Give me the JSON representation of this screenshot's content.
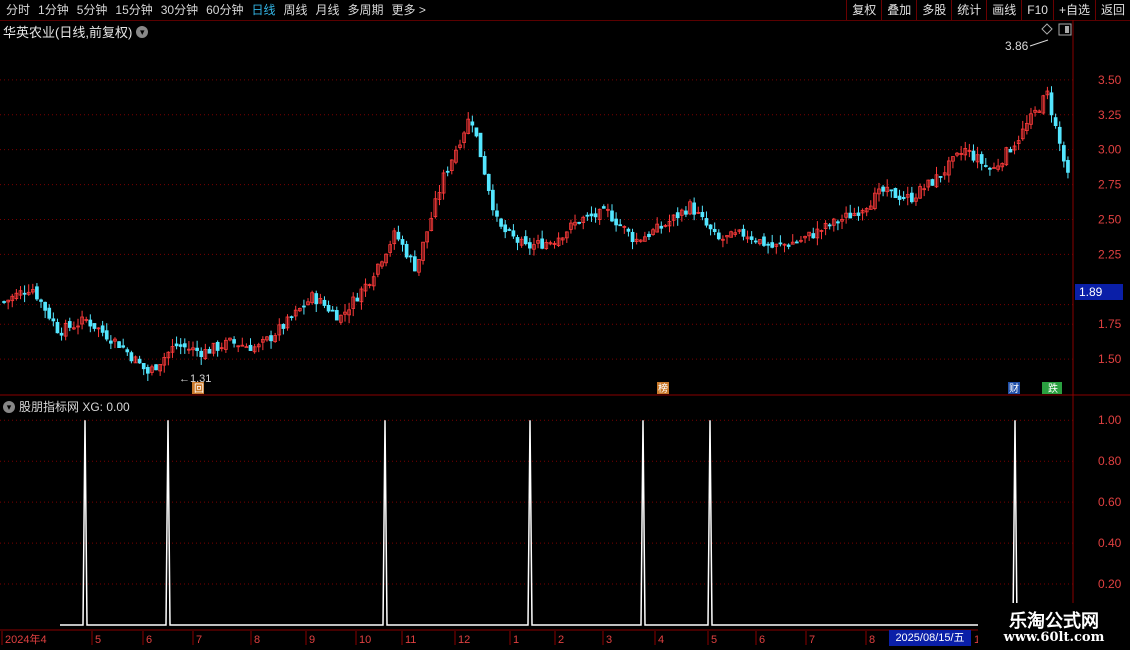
{
  "toolbar": {
    "periods": [
      "分时",
      "1分钟",
      "5分钟",
      "15分钟",
      "30分钟",
      "60分钟",
      "日线",
      "周线",
      "月线",
      "多周期",
      "更多 >"
    ],
    "active_period": "日线",
    "buttons": [
      "复权",
      "叠加",
      "多股",
      "统计",
      "画线",
      "F10",
      "+自选",
      "返回"
    ]
  },
  "stock": {
    "title": "华英农业(日线,前复权)"
  },
  "price_axis": {
    "ticks": [
      "3.50",
      "3.25",
      "3.00",
      "2.75",
      "2.50",
      "2.25",
      "1.75",
      "1.50"
    ],
    "current": "1.89"
  },
  "annotations": {
    "high": "3.86",
    "low": "1.31",
    "badge_hui": "回",
    "badge_bang": "榜",
    "badge_cai": "财",
    "badge_die": "跌"
  },
  "indicator": {
    "title": "股朋指标网 XG: 0.00",
    "ticks": [
      "1.00",
      "0.80",
      "0.60",
      "0.40",
      "0.20"
    ]
  },
  "time_axis": {
    "labels": [
      "2024年4",
      "5",
      "6",
      "7",
      "8",
      "9",
      "10",
      "11",
      "12",
      "1",
      "2",
      "3",
      "4",
      "5",
      "6",
      "7",
      "8"
    ],
    "current_date": "2025/08/15/五",
    "tail": "1"
  },
  "watermark": {
    "title": "乐淘公式网",
    "url": "www.60lt.com"
  },
  "colors": {
    "up": "#ff3b3b",
    "down": "#54e6ff",
    "grid": "#7a0000",
    "active": "#33b5e5",
    "highlight": "#0a1fa8"
  },
  "chart_data": {
    "type": "candlestick",
    "title": "华英农业(日线,前复权)",
    "y_ticks": [
      3.5,
      3.25,
      3.0,
      2.75,
      2.5,
      2.25,
      1.75,
      1.5
    ],
    "ylim": [
      1.25,
      3.9
    ],
    "close_path": [
      [
        2024.25,
        1.91
      ],
      [
        2024.29,
        2.02
      ],
      [
        2024.33,
        1.7
      ],
      [
        2024.37,
        1.78
      ],
      [
        2024.42,
        1.6
      ],
      [
        2024.46,
        1.4
      ],
      [
        2024.5,
        1.6
      ],
      [
        2024.54,
        1.55
      ],
      [
        2024.58,
        1.62
      ],
      [
        2024.62,
        1.58
      ],
      [
        2024.66,
        1.75
      ],
      [
        2024.7,
        1.95
      ],
      [
        2024.74,
        1.8
      ],
      [
        2024.78,
        2.05
      ],
      [
        2024.82,
        2.4
      ],
      [
        2024.85,
        2.15
      ],
      [
        2024.89,
        2.8
      ],
      [
        2024.93,
        3.25
      ],
      [
        2024.97,
        2.45
      ],
      [
        2025.01,
        2.3
      ],
      [
        2025.05,
        2.35
      ],
      [
        2025.09,
        2.5
      ],
      [
        2025.13,
        2.55
      ],
      [
        2025.17,
        2.35
      ],
      [
        2025.21,
        2.45
      ],
      [
        2025.25,
        2.6
      ],
      [
        2025.29,
        2.35
      ],
      [
        2025.33,
        2.4
      ],
      [
        2025.37,
        2.3
      ],
      [
        2025.41,
        2.35
      ],
      [
        2025.45,
        2.45
      ],
      [
        2025.49,
        2.55
      ],
      [
        2025.53,
        2.7
      ],
      [
        2025.57,
        2.65
      ],
      [
        2025.61,
        2.8
      ],
      [
        2025.65,
        3.0
      ],
      [
        2025.69,
        2.85
      ],
      [
        2025.73,
        3.1
      ],
      [
        2025.77,
        3.4
      ],
      [
        2025.8,
        2.8
      ]
    ],
    "high": 3.86,
    "low": 1.31,
    "current_price": 1.89,
    "indicator": {
      "name": "XG",
      "value": 0.0,
      "signal_positions": [
        1,
        2,
        7,
        10,
        12,
        13,
        19
      ],
      "ylim": [
        0,
        1.05
      ]
    }
  }
}
